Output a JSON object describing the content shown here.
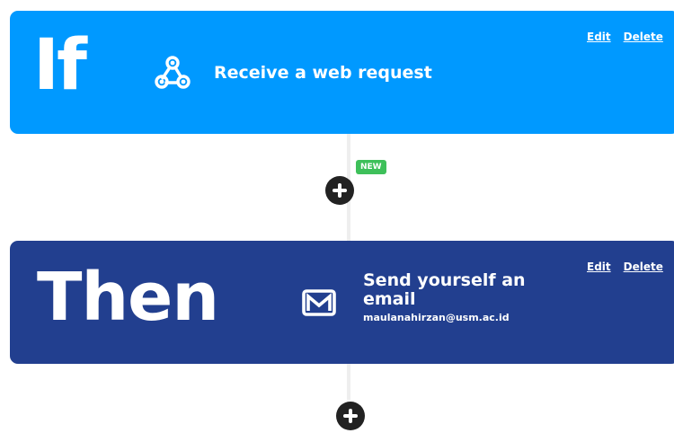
{
  "colors": {
    "if_card": "#0099ff",
    "then_card": "#223f8f",
    "new_badge": "#3ec05a",
    "add_button": "#222222",
    "connector": "#eeeeee"
  },
  "if_card": {
    "keyword": "If",
    "icon": "webhook-icon",
    "action_title": "Receive a web request",
    "edit_label": "Edit",
    "delete_label": "Delete"
  },
  "add_step_top": {
    "icon": "plus-icon",
    "badge": "NEW"
  },
  "then_card": {
    "keyword": "Then",
    "icon": "email-icon",
    "action_title": "Send yourself an email",
    "action_subtitle": "maulanahirzan@usm.ac.id",
    "edit_label": "Edit",
    "delete_label": "Delete"
  },
  "add_step_bottom": {
    "icon": "plus-icon"
  }
}
